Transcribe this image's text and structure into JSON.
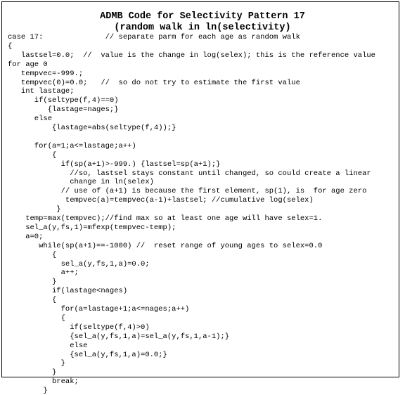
{
  "title": {
    "line1": "ADMB Code for Selectivity Pattern 17",
    "line2": "(random walk in ln(selectivity)"
  },
  "code": [
    "case 17:              // separate parm for each age as random walk",
    "{",
    "   lastsel=0.0;  //  value is the change in log(selex); this is the reference value",
    "for age 0",
    "   tempvec=-999.;",
    "   tempvec(0)=0.0;   //  so do not try to estimate the first value",
    "   int lastage;",
    "      if(seltype(f,4)==0)",
    "         {lastage=nages;}",
    "      else",
    "          {lastage=abs(seltype(f,4));}",
    "",
    "      for(a=1;a<=lastage;a++)",
    "          {",
    "            if(sp(a+1)>-999.) {lastsel=sp(a+1);}",
    "              //so, lastsel stays constant until changed, so could create a linear",
    "              change in ln(selex)",
    "            // use of (a+1) is because the first element, sp(1), is  for age zero",
    "             tempvec(a)=tempvec(a-1)+lastsel; //cumulative log(selex)",
    "           }",
    "    temp=max(tempvec);//find max so at least one age will have selex=1.",
    "    sel_a(y,fs,1)=mfexp(tempvec-temp);",
    "    a=0;",
    "       while(sp(a+1)==-1000) //  reset range of young ages to selex=0.0",
    "          {",
    "            sel_a(y,fs,1,a)=0.0;",
    "            a++;",
    "          }",
    "          if(lastage<nages)",
    "          {",
    "            for(a=lastage+1;a<=nages;a++)",
    "            {",
    "              if(seltype(f,4)>0)",
    "              {sel_a(y,fs,1,a)=sel_a(y,fs,1,a-1);}",
    "              else",
    "              {sel_a(y,fs,1,a)=0.0;}",
    "            }",
    "          }",
    "          break;",
    "        }"
  ]
}
